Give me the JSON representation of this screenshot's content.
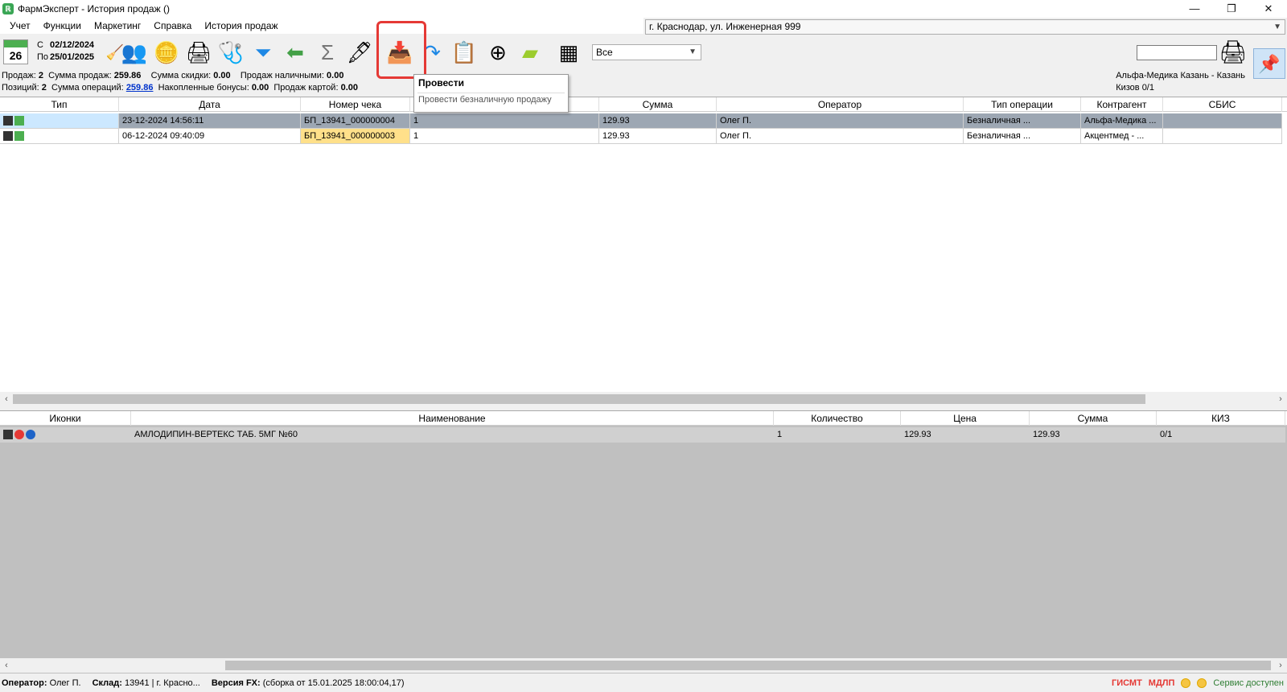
{
  "window": {
    "title": "ФармЭксперт - История продаж ()",
    "controls": [
      "—",
      "❐",
      "✕"
    ]
  },
  "menu": [
    "Учет",
    "Функции",
    "Маркетинг",
    "Справка",
    "История продаж"
  ],
  "store_address": "г. Краснодар, ул. Инженерная 999",
  "calendar_day": "26",
  "date_from_label": "С",
  "date_from": "02/12/2024",
  "date_to_label": "По",
  "date_to": "25/01/2025",
  "mode_select": "Все",
  "stats": {
    "sales_label": "Продаж:",
    "sales": "2",
    "sales_sum_label": "Сумма продаж:",
    "sales_sum": "259.86",
    "discount_label": "Сумма скидки:",
    "discount": "0.00",
    "cash_label": "Продаж наличными:",
    "cash": "0.00",
    "positions_label": "Позиций:",
    "positions": "2",
    "ops_label": "Сумма операций:",
    "ops": "259.86",
    "bonus_label": "Накопленные бонусы:",
    "bonus": "0.00",
    "card_label": "Продаж картой:",
    "card": "0.00"
  },
  "right_info": {
    "partner": "Альфа-Медика Казань - Казань",
    "kiz": "Кизов 0/1"
  },
  "tooltip": {
    "title": "Провести",
    "desc": "Провести безналичную продажу"
  },
  "sales_table": {
    "columns": [
      "Тип",
      "Дата",
      "Номер чека",
      "",
      "Сумма",
      "Оператор",
      "Тип операции",
      "Контрагент",
      "СБИС"
    ],
    "rows": [
      [
        "",
        "23-12-2024 14:56:11",
        "БП_13941_000000004",
        "1",
        "129.93",
        "Олег П.",
        "Безналичная ...",
        "Альфа-Медика ...",
        ""
      ],
      [
        "",
        "06-12-2024 09:40:09",
        "БП_13941_000000003",
        "1",
        "129.93",
        "Олег П.",
        "Безналичная ...",
        "Акцентмед - ...",
        ""
      ]
    ]
  },
  "items_table": {
    "columns": [
      "Иконки",
      "Наименование",
      "Количество",
      "Цена",
      "Сумма",
      "КИЗ"
    ],
    "rows": [
      [
        "",
        "АМЛОДИПИН-ВЕРТЕКС ТАБ. 5МГ №60",
        "1",
        "129.93",
        "129.93",
        "0/1"
      ]
    ]
  },
  "status": {
    "operator_label": "Оператор:",
    "operator": "Олег П.",
    "warehouse_label": "Склад:",
    "warehouse": "13941 | г. Красно...",
    "version_label": "Версия FX:",
    "version": "(сборка от 15.01.2025 18:00:04,17)",
    "gismt": "ГИСМТ",
    "mdlp": "МДЛП",
    "service": "Сервис доступен"
  },
  "colors": {
    "selected_row": "#9da7b3",
    "highlight_cell": "#ffe08a",
    "red_frame": "#e53935",
    "link": "#0033cc"
  }
}
